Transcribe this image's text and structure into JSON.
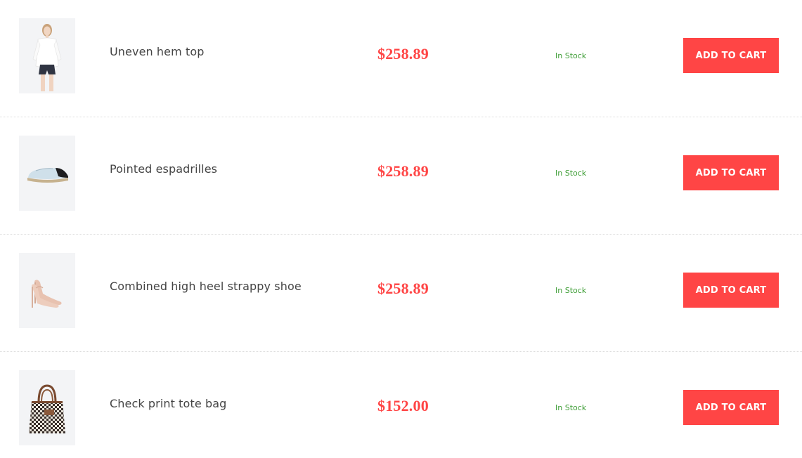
{
  "theme": {
    "accent": "#ff4545",
    "stock_color": "#3f9e37",
    "thumb_bg": "#f3f4f6"
  },
  "products": [
    {
      "name": "Uneven hem top",
      "price": "$258.89",
      "stock": "In Stock",
      "cart_label": "ADD TO CART",
      "icon": "blouse-model-icon"
    },
    {
      "name": "Pointed espadrilles",
      "price": "$258.89",
      "stock": "In Stock",
      "cart_label": "ADD TO CART",
      "icon": "espadrille-shoe-icon"
    },
    {
      "name": "Combined high heel strappy shoe",
      "price": "$258.89",
      "stock": "In Stock",
      "cart_label": "ADD TO CART",
      "icon": "high-heel-shoe-icon"
    },
    {
      "name": "Check print tote bag",
      "price": "$152.00",
      "stock": "In Stock",
      "cart_label": "ADD TO CART",
      "icon": "tote-bag-icon"
    }
  ]
}
